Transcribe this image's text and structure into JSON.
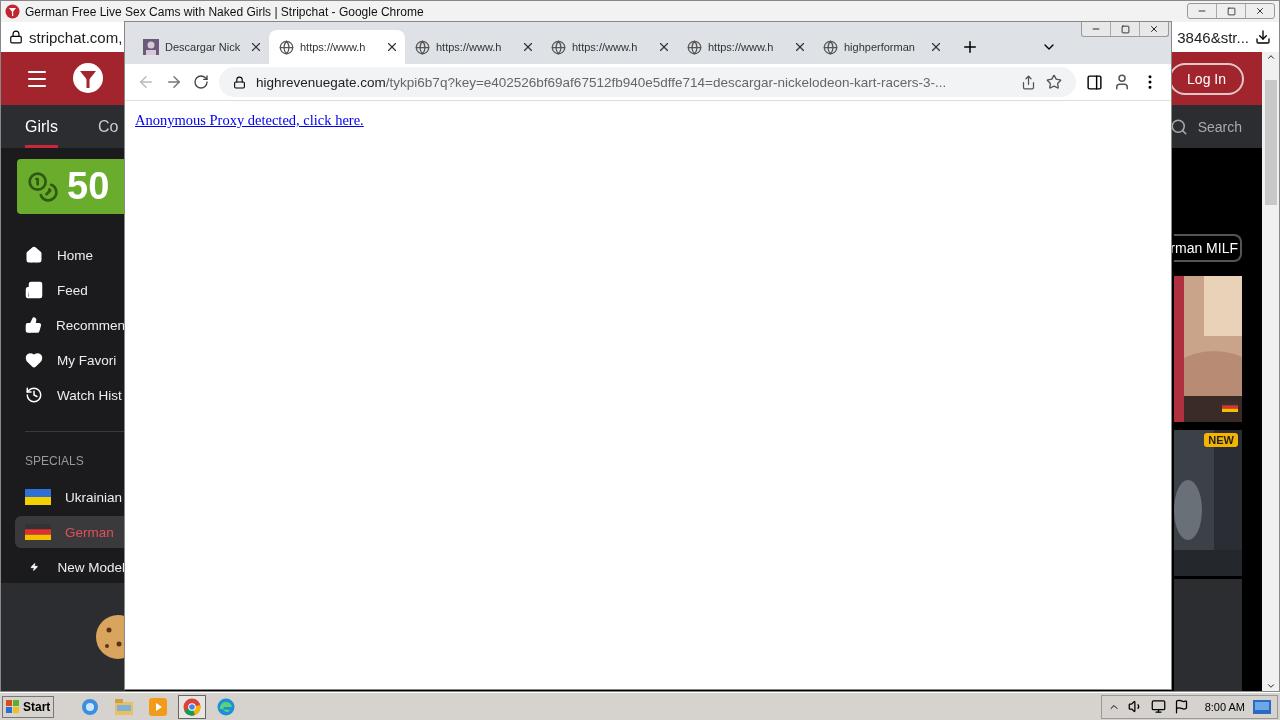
{
  "back_window": {
    "title": "German Free Live Sex Cams with Naked Girls | Stripchat - Google Chrome",
    "address": "stripchat.com,",
    "address_tail": "3846&str...",
    "login": "Log In",
    "nav_tabs": [
      {
        "label": "Girls",
        "selected": true
      },
      {
        "label": "Co",
        "selected": false
      }
    ],
    "search": "Search",
    "promo": "50",
    "menu": [
      {
        "label": "Home"
      },
      {
        "label": "Feed"
      },
      {
        "label": "Recommen"
      },
      {
        "label": "My Favori"
      },
      {
        "label": "Watch Hist"
      }
    ],
    "section": "SPECIALS",
    "specials": [
      {
        "label": "Ukrainian",
        "kind": "ukraine",
        "selected": false
      },
      {
        "label": "German",
        "kind": "germany",
        "selected": true
      },
      {
        "label": "New Model",
        "kind": "bolt",
        "selected": false
      }
    ],
    "chip": "rman MILF",
    "cards": [
      {
        "kind": "picture",
        "flag": true
      },
      {
        "kind": "picture",
        "badge": "NEW"
      }
    ]
  },
  "front_window": {
    "tabs": [
      {
        "title": "Descargar Nick",
        "kind": "avatar",
        "selected": false
      },
      {
        "title": "https://www.h",
        "kind": "globe",
        "selected": true
      },
      {
        "title": "https://www.h",
        "kind": "globe",
        "selected": false
      },
      {
        "title": "https://www.h",
        "kind": "globe",
        "selected": false
      },
      {
        "title": "https://www.h",
        "kind": "globe",
        "selected": false
      },
      {
        "title": "highperforman",
        "kind": "globe",
        "selected": false
      }
    ],
    "back_disabled": true,
    "address_host": "highrevenuegate.com",
    "address_path": "/tykpi6b7q?key=e402526bf69af67512fb940e5dffe714=descargar-nickelodeon-kart-racers-3-...",
    "link": "Anonymous Proxy detected, click here."
  },
  "taskbar": {
    "start": "Start",
    "apps": [
      {
        "kind": "ie",
        "active": false
      },
      {
        "kind": "folder",
        "active": false
      },
      {
        "kind": "media",
        "active": false
      },
      {
        "kind": "chrome",
        "active": true
      },
      {
        "kind": "edge",
        "active": false
      }
    ],
    "clock": "8:00 AM"
  }
}
